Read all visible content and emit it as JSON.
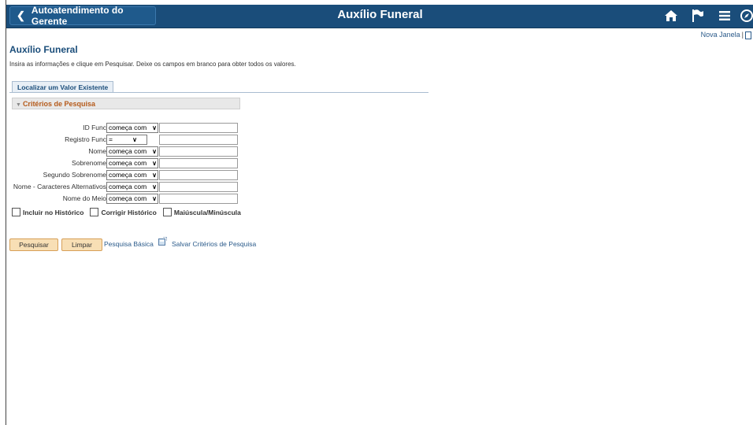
{
  "header": {
    "back_label": "Autoatendimento do Gerente",
    "title": "Auxílio Funeral"
  },
  "top_links": {
    "new_window": "Nova Janela",
    "separator": "|"
  },
  "page": {
    "title": "Auxílio Funeral",
    "instructions": "Insira as informações e clique em Pesquisar. Deixe os campos em branco para obter todos os valores."
  },
  "tab": {
    "label": "Localizar um Valor Existente"
  },
  "criteria": {
    "header": "Critérios de Pesquisa"
  },
  "fields": [
    {
      "label": "ID Func",
      "operator": "começa com"
    },
    {
      "label": "Registro Func",
      "operator": "="
    },
    {
      "label": "Nome",
      "operator": "começa com"
    },
    {
      "label": "Sobrenome",
      "operator": "começa com"
    },
    {
      "label": "Segundo Sobrenome",
      "operator": "começa com"
    },
    {
      "label": "Nome - Caracteres Alternativos",
      "operator": "começa com"
    },
    {
      "label": "Nome do Meio",
      "operator": "começa com"
    }
  ],
  "checkboxes": [
    {
      "label": "Incluir no Histórico"
    },
    {
      "label": "Corrigir Histórico"
    },
    {
      "label": "Maiúscula/Minúscula"
    }
  ],
  "actions": {
    "search": "Pesquisar",
    "clear": "Limpar",
    "basic_search": "Pesquisa Básica",
    "save_criteria": "Salvar Critérios de Pesquisa"
  },
  "colors": {
    "header_bg": "#1a4d7a",
    "accent": "#b55a1a",
    "button_bg": "#f8dfb5"
  }
}
